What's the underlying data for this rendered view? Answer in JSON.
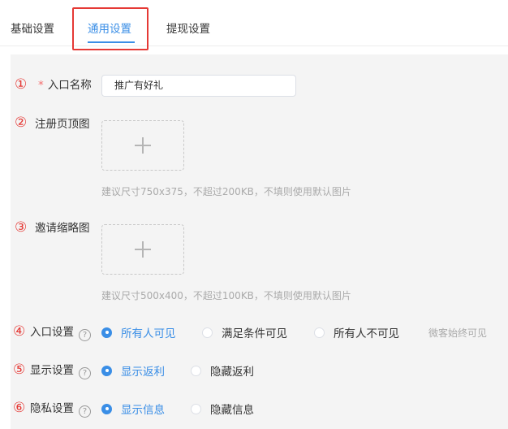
{
  "tabs": {
    "basic": "基础设置",
    "general": "通用设置",
    "withdraw": "提现设置"
  },
  "markers": [
    "①",
    "②",
    "③",
    "④",
    "⑤",
    "⑥"
  ],
  "entry_name": {
    "required_mark": "*",
    "label": "入口名称",
    "value": "推广有好礼"
  },
  "register_image": {
    "label": "注册页顶图",
    "hint": "建议尺寸750x375，不超过200KB，不填则使用默认图片"
  },
  "invite_thumb": {
    "label": "邀请缩略图",
    "hint": "建议尺寸500x400，不超过100KB，不填则使用默认图片"
  },
  "entry_setting": {
    "label": "入口设置",
    "options": [
      "所有人可见",
      "满足条件可见",
      "所有人不可见"
    ],
    "selected": 0,
    "note": "微客始终可见"
  },
  "display_setting": {
    "label": "显示设置",
    "options": [
      "显示返利",
      "隐藏返利"
    ],
    "selected": 0
  },
  "privacy_setting": {
    "label": "隐私设置",
    "options": [
      "显示信息",
      "隐藏信息"
    ],
    "selected": 0
  },
  "help_glyph": "?",
  "colors": {
    "accent": "#3a8ee6",
    "annotation_red": "#e53935",
    "panel_bg": "#f4f4f4"
  }
}
